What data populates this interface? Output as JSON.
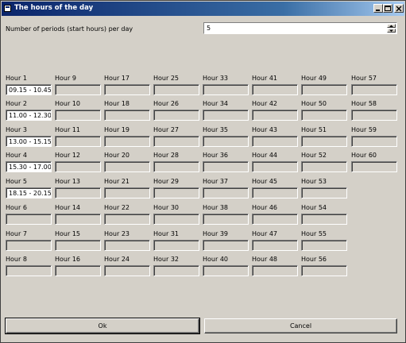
{
  "window": {
    "title": "The hours of the day",
    "buttons": {
      "minimize": "_",
      "maximize": "□",
      "close": "×"
    }
  },
  "periods": {
    "label": "Number of periods (start hours) per day",
    "value": "5"
  },
  "hours": [
    {
      "label": "Hour 1",
      "value": "09.15 - 10.45"
    },
    {
      "label": "Hour 2",
      "value": "11.00 - 12.30"
    },
    {
      "label": "Hour 3",
      "value": "13.00 - 15.15"
    },
    {
      "label": "Hour 4",
      "value": "15.30 - 17.00"
    },
    {
      "label": "Hour 5",
      "value": "18.15 - 20.15"
    },
    {
      "label": "Hour 6",
      "value": ""
    },
    {
      "label": "Hour 7",
      "value": ""
    },
    {
      "label": "Hour 8",
      "value": ""
    },
    {
      "label": "Hour 9",
      "value": ""
    },
    {
      "label": "Hour 10",
      "value": ""
    },
    {
      "label": "Hour 11",
      "value": ""
    },
    {
      "label": "Hour 12",
      "value": ""
    },
    {
      "label": "Hour 13",
      "value": ""
    },
    {
      "label": "Hour 14",
      "value": ""
    },
    {
      "label": "Hour 15",
      "value": ""
    },
    {
      "label": "Hour 16",
      "value": ""
    },
    {
      "label": "Hour 17",
      "value": ""
    },
    {
      "label": "Hour 18",
      "value": ""
    },
    {
      "label": "Hour 19",
      "value": ""
    },
    {
      "label": "Hour 20",
      "value": ""
    },
    {
      "label": "Hour 21",
      "value": ""
    },
    {
      "label": "Hour 22",
      "value": ""
    },
    {
      "label": "Hour 23",
      "value": ""
    },
    {
      "label": "Hour 24",
      "value": ""
    },
    {
      "label": "Hour 25",
      "value": ""
    },
    {
      "label": "Hour 26",
      "value": ""
    },
    {
      "label": "Hour 27",
      "value": ""
    },
    {
      "label": "Hour 28",
      "value": ""
    },
    {
      "label": "Hour 29",
      "value": ""
    },
    {
      "label": "Hour 30",
      "value": ""
    },
    {
      "label": "Hour 31",
      "value": ""
    },
    {
      "label": "Hour 32",
      "value": ""
    },
    {
      "label": "Hour 33",
      "value": ""
    },
    {
      "label": "Hour 34",
      "value": ""
    },
    {
      "label": "Hour 35",
      "value": ""
    },
    {
      "label": "Hour 36",
      "value": ""
    },
    {
      "label": "Hour 37",
      "value": ""
    },
    {
      "label": "Hour 38",
      "value": ""
    },
    {
      "label": "Hour 39",
      "value": ""
    },
    {
      "label": "Hour 40",
      "value": ""
    },
    {
      "label": "Hour 41",
      "value": ""
    },
    {
      "label": "Hour 42",
      "value": ""
    },
    {
      "label": "Hour 43",
      "value": ""
    },
    {
      "label": "Hour 44",
      "value": ""
    },
    {
      "label": "Hour 45",
      "value": ""
    },
    {
      "label": "Hour 46",
      "value": ""
    },
    {
      "label": "Hour 47",
      "value": ""
    },
    {
      "label": "Hour 48",
      "value": ""
    },
    {
      "label": "Hour 49",
      "value": ""
    },
    {
      "label": "Hour 50",
      "value": ""
    },
    {
      "label": "Hour 51",
      "value": ""
    },
    {
      "label": "Hour 52",
      "value": ""
    },
    {
      "label": "Hour 53",
      "value": ""
    },
    {
      "label": "Hour 54",
      "value": ""
    },
    {
      "label": "Hour 55",
      "value": ""
    },
    {
      "label": "Hour 56",
      "value": ""
    },
    {
      "label": "Hour 57",
      "value": ""
    },
    {
      "label": "Hour 58",
      "value": ""
    },
    {
      "label": "Hour 59",
      "value": ""
    },
    {
      "label": "Hour 60",
      "value": ""
    }
  ],
  "footer": {
    "ok_label": "Ok",
    "cancel_label": "Cancel"
  }
}
